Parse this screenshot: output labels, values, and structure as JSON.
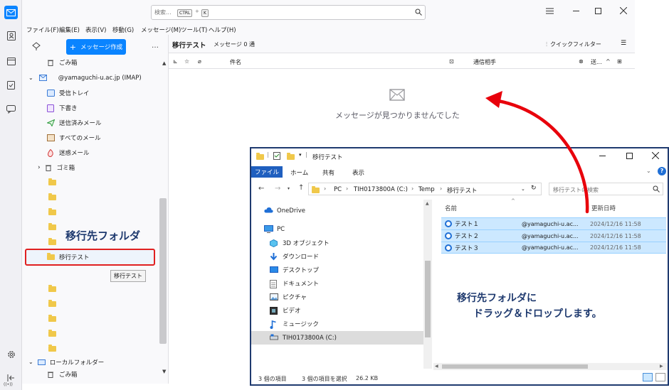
{
  "thunderbird": {
    "search": {
      "placeholder": "検索...",
      "key1": "CTRL",
      "plus": "+",
      "key2": "K"
    },
    "menu": [
      "ファイル(F)",
      "編集(E)",
      "表示(V)",
      "移動(G)",
      "メッセージ(M)",
      "ツール(T)",
      "ヘルプ(H)"
    ],
    "write_button": "メッセージ作成",
    "folders": {
      "trash_top": "ごみ箱",
      "account": "@yamaguchi-u.ac.jp (IMAP)",
      "inbox": "受信トレイ",
      "drafts": "下書き",
      "sent": "送信済みメール",
      "all_mail": "すべてのメール",
      "spam": "迷惑メール",
      "trash": "ゴミ箱",
      "target": "移行テスト",
      "tooltip": "移行テスト",
      "local": "ローカルフォルダー",
      "local_trash": "ごみ箱"
    },
    "message_header": {
      "folder_name": "移行テスト",
      "count": "メッセージ 0 通",
      "quick_filter": "クイックフィルター"
    },
    "columns": {
      "subject": "件名",
      "correspondent": "通信相手",
      "sent": "送..."
    },
    "empty_message": "メッセージが見つかりませんでした"
  },
  "annotation": {
    "target_label": "移行先フォルダ",
    "instruction_line1": "移行先フォルダに",
    "instruction_line2": "ドラッグ＆ドロップします。"
  },
  "explorer": {
    "title": "移行テスト",
    "tabs": [
      "ファイル",
      "ホーム",
      "共有",
      "表示"
    ],
    "breadcrumb": [
      "PC",
      "TIH0173800A (C:)",
      "Temp",
      "移行テスト"
    ],
    "search_placeholder": "移行テストの検索",
    "nav": {
      "onedrive": "OneDrive",
      "pc": "PC",
      "objects3d": "3D オブジェクト",
      "downloads": "ダウンロード",
      "desktop": "デスクトップ",
      "documents": "ドキュメント",
      "pictures": "ピクチャ",
      "videos": "ビデオ",
      "music": "ミュージック",
      "drive": "TIH0173800A (C:)"
    },
    "columns": {
      "name": "名前",
      "modified": "更新日時"
    },
    "files": [
      {
        "name": "テスト１",
        "from": "@yamaguchi-u.ac...",
        "date": "2024/12/16 11:58"
      },
      {
        "name": "テスト２",
        "from": "@yamaguchi-u.ac...",
        "date": "2024/12/16 11:58"
      },
      {
        "name": "テスト３",
        "from": "@yamaguchi-u.ac...",
        "date": "2024/12/16 11:58"
      }
    ],
    "status": {
      "items": "3 個の項目",
      "selected": "3 個の項目を選択",
      "size": "26.2 KB"
    }
  },
  "colors": {
    "accent": "#0a84ff",
    "annotation": "#1f3a6f",
    "arrow": "#e8000b",
    "selection": "#cce8ff"
  }
}
